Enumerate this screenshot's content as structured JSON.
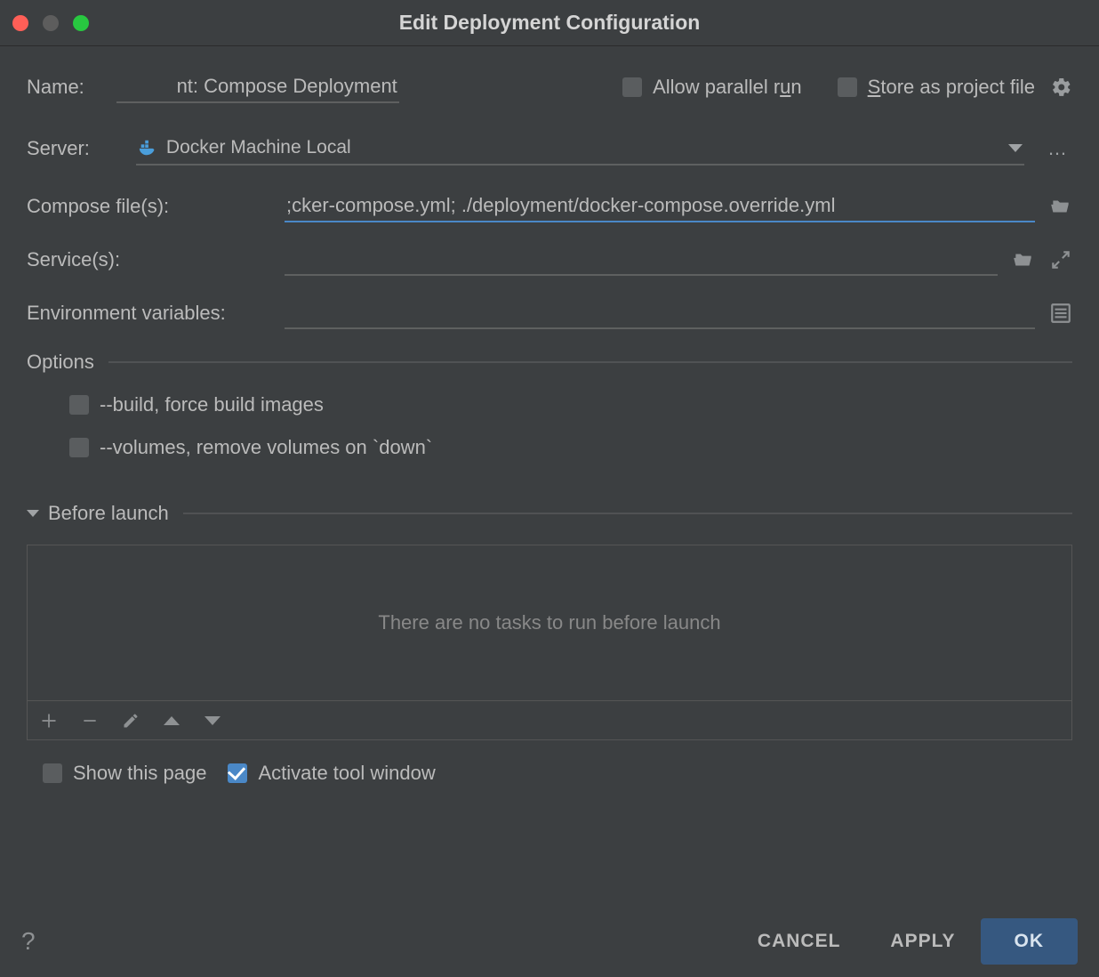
{
  "title": "Edit Deployment Configuration",
  "labels": {
    "name": "Name:",
    "server": "Server:",
    "compose": "Compose file(s):",
    "services": "Service(s):",
    "env": "Environment variables:",
    "options": "Options",
    "before": "Before launch"
  },
  "fields": {
    "name_value": "nt: Compose Deployment",
    "server_value": "Docker Machine Local",
    "compose_value": "cker-compose.yml; ./deployment/docker-compose.override.yml;",
    "services_value": "",
    "env_value": ""
  },
  "checks": {
    "allow_parallel": "Allow parallel r",
    "allow_parallel_u": "u",
    "allow_parallel_rest": "n",
    "store_pf_s": "S",
    "store_pf_rest": "tore as project file",
    "build": "--build, force build images",
    "volumes": "--volumes, remove volumes on `down`",
    "show_page": "Show this page",
    "activate_tool": "Activate tool window"
  },
  "before_empty": "There are no tasks to run before launch",
  "buttons": {
    "cancel": "CANCEL",
    "apply": "APPLY",
    "ok": "OK"
  }
}
